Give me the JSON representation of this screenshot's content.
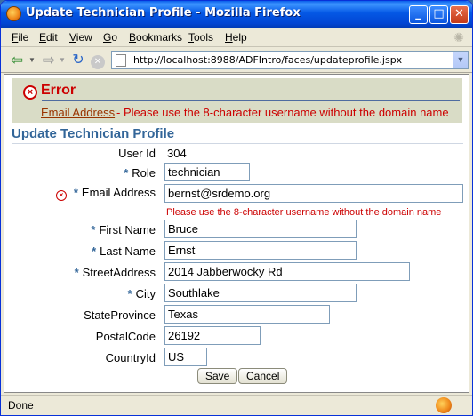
{
  "window": {
    "title": "Update Technician Profile - Mozilla Firefox",
    "minimize": "_",
    "maximize": "□",
    "close": "✕"
  },
  "menu": [
    "File",
    "Edit",
    "View",
    "Go",
    "Bookmarks",
    "Tools",
    "Help"
  ],
  "menu_mnemonics": [
    "F",
    "E",
    "V",
    "G",
    "B",
    "T",
    "H"
  ],
  "nav": {
    "url": "http://localhost:8988/ADFIntro/faces/updateprofile.jspx",
    "icons": [
      "back-icon",
      "forward-icon",
      "reload-icon",
      "stop-icon"
    ]
  },
  "error": {
    "title": "Error",
    "link": "Email Address",
    "message": "- Please use the 8-character username without the domain name"
  },
  "page_title": "Update Technician Profile",
  "form": {
    "user_id_label": "User Id",
    "user_id_value": "304",
    "role_label": "Role",
    "role_value": "technician",
    "email_label": "Email Address",
    "email_value": "bernst@srdemo.org",
    "email_error": "Please use the 8-character username without the domain name",
    "first_name_label": "First Name",
    "first_name_value": "Bruce",
    "last_name_label": "Last Name",
    "last_name_value": "Ernst",
    "street_label": "StreetAddress",
    "street_value": "2014 Jabberwocky Rd",
    "city_label": "City",
    "city_value": "Southlake",
    "state_label": "StateProvince",
    "state_value": "Texas",
    "postal_label": "PostalCode",
    "postal_value": "26192",
    "country_label": "CountryId",
    "country_value": "US",
    "required_mark": "*"
  },
  "buttons": {
    "save": "Save",
    "cancel": "Cancel"
  },
  "status": {
    "text": "Done"
  },
  "colors": {
    "error": "#cc0000",
    "accent": "#336699"
  }
}
